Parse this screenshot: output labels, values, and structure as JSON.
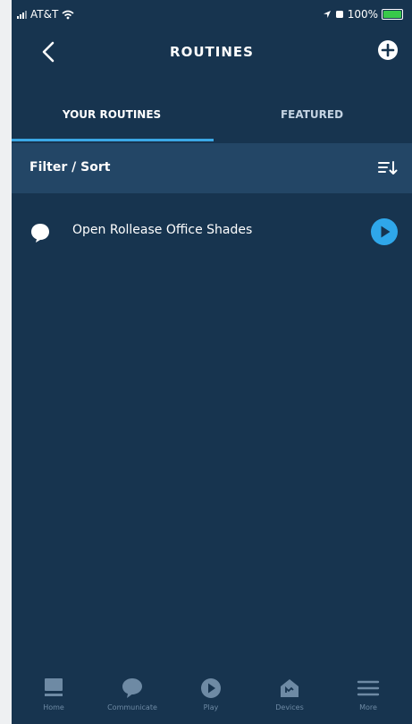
{
  "status_bar": {
    "carrier": "AT&T",
    "battery": "100%"
  },
  "header": {
    "title": "ROUTINES"
  },
  "tabs": [
    {
      "label": "YOUR ROUTINES",
      "active": true
    },
    {
      "label": "FEATURED",
      "active": false
    }
  ],
  "filter": {
    "label": "Filter / Sort"
  },
  "routines": [
    {
      "label": "Open Rollease Office Shades"
    }
  ],
  "bottom_nav": [
    {
      "label": "Home",
      "icon": "home-icon"
    },
    {
      "label": "Communicate",
      "icon": "chat-bubble-icon"
    },
    {
      "label": "Play",
      "icon": "play-icon"
    },
    {
      "label": "Devices",
      "icon": "devices-icon"
    },
    {
      "label": "More",
      "icon": "menu-icon"
    }
  ],
  "colors": {
    "background": "#17344f",
    "filter_bar": "#234666",
    "accent": "#2fa7ea",
    "nav_inactive": "#6e8aa4"
  }
}
